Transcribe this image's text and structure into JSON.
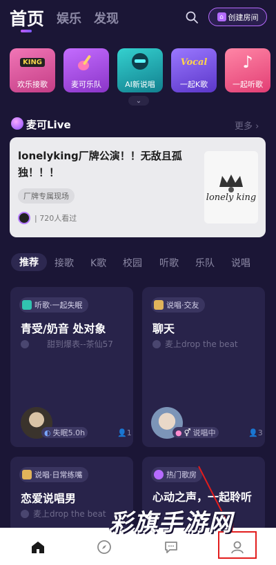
{
  "header": {
    "tabs": [
      "首页",
      "娱乐",
      "发现"
    ],
    "create_room": "创建房间"
  },
  "categories": [
    {
      "label": "欢乐接歌",
      "art": "KING",
      "color": "#e9559b"
    },
    {
      "label": "麦可乐队",
      "art": "",
      "color": "#a34fd8"
    },
    {
      "label": "AI新说唱",
      "art": "",
      "color": "#1fb1b6"
    },
    {
      "label": "一起K歌",
      "art": "Vocal",
      "color": "#7a52e6"
    },
    {
      "label": "一起听歌",
      "art": "",
      "color": "#f25a8a"
    }
  ],
  "live": {
    "section_title": "麦可Live",
    "more": "更多",
    "headline": "lonelyking厂牌公演！！无敌且孤独！！！",
    "tag": "厂牌专属现场",
    "viewers": "720人看过",
    "poster_text": "lonely king"
  },
  "filters": [
    "推荐",
    "接歌",
    "K歌",
    "校园",
    "听歌",
    "乐队",
    "说唱"
  ],
  "rooms": [
    {
      "badge": "听歌·一起失眠",
      "title": "青受/奶音 处对象",
      "song": "甜到爆表--茶仙57",
      "status": "失眠5.0h",
      "members": "1"
    },
    {
      "badge": "说唱·交友",
      "title": "聊天",
      "song": "麦上drop the beat",
      "status": "说唱中",
      "members": "3"
    },
    {
      "badge": "说唱·日常练嘴",
      "title": "恋爱说唱男",
      "song": "麦上drop the beat"
    },
    {
      "badge": "热门歌房",
      "title": "心动之声，一起聆听"
    }
  ],
  "watermark": "彩旗手游网",
  "colors": {
    "accent": "#b86bff",
    "background": "#1b1636",
    "card": "#28234a",
    "annotation": "#e21c1c"
  }
}
